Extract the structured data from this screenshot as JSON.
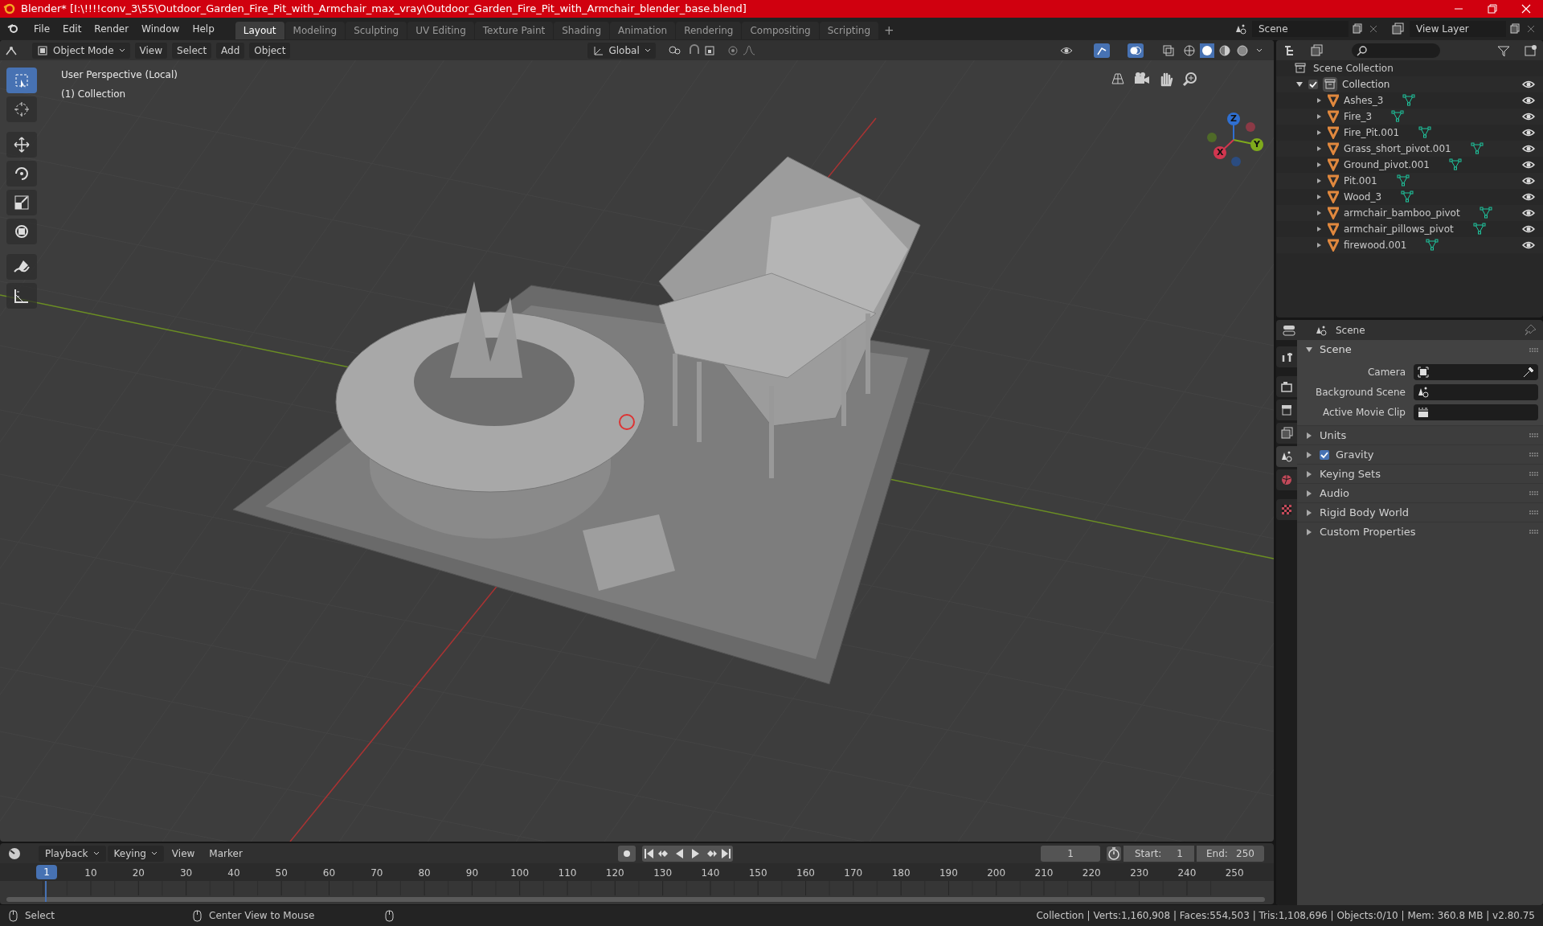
{
  "title_bar": {
    "title": "Blender* [I:\\!!!!conv_3\\55\\Outdoor_Garden_Fire_Pit_with_Armchair_max_vray\\Outdoor_Garden_Fire_Pit_with_Armchair_blender_base.blend]"
  },
  "menu": [
    "File",
    "Edit",
    "Render",
    "Window",
    "Help"
  ],
  "workspaces": [
    {
      "label": "Layout",
      "selected": true
    },
    {
      "label": "Modeling",
      "selected": false
    },
    {
      "label": "Sculpting",
      "selected": false
    },
    {
      "label": "UV Editing",
      "selected": false
    },
    {
      "label": "Texture Paint",
      "selected": false
    },
    {
      "label": "Shading",
      "selected": false
    },
    {
      "label": "Animation",
      "selected": false
    },
    {
      "label": "Rendering",
      "selected": false
    },
    {
      "label": "Compositing",
      "selected": false
    },
    {
      "label": "Scripting",
      "selected": false
    }
  ],
  "add_workspace": "+",
  "scene_field": "Scene",
  "view_layer_field": "View Layer",
  "viewport": {
    "mode": "Object Mode",
    "menus": [
      "View",
      "Select",
      "Add",
      "Object"
    ],
    "orientation": "Global",
    "overlay_text": [
      "User Perspective (Local)",
      "(1) Collection"
    ],
    "tools": [
      {
        "kind": "select",
        "selected": true
      },
      {
        "kind": "cursor",
        "selected": false
      },
      {
        "kind": "move",
        "selected": false
      },
      {
        "kind": "rotate",
        "selected": false
      },
      {
        "kind": "scale",
        "selected": false
      },
      {
        "kind": "transform",
        "selected": false
      },
      {
        "kind": "annotate",
        "selected": false
      },
      {
        "kind": "measure",
        "selected": false
      }
    ],
    "gizmo_axes": [
      "Z",
      "Y",
      "X"
    ]
  },
  "outliner": {
    "root": "Scene Collection",
    "collection": {
      "label": "Collection",
      "checked": true,
      "expanded": true,
      "children": [
        {
          "label": "Ashes_3"
        },
        {
          "label": "Fire_3"
        },
        {
          "label": "Fire_Pit.001"
        },
        {
          "label": "Grass_short_pivot.001"
        },
        {
          "label": "Ground_pivot.001"
        },
        {
          "label": "Pit.001"
        },
        {
          "label": "Wood_3"
        },
        {
          "label": "armchair_bamboo_pivot"
        },
        {
          "label": "armchair_pillows_pivot"
        },
        {
          "label": "firewood.001"
        }
      ]
    }
  },
  "properties": {
    "header": "Scene",
    "tabs": [
      {
        "kind": "tool",
        "selected": false
      },
      {
        "kind": "render",
        "selected": false
      },
      {
        "kind": "output",
        "selected": false
      },
      {
        "kind": "view_layer",
        "selected": false
      },
      {
        "kind": "scene",
        "selected": true
      },
      {
        "kind": "world",
        "selected": false
      },
      {
        "kind": "texture",
        "selected": false
      }
    ],
    "panel": {
      "title": "Scene",
      "expanded": true,
      "fields": [
        {
          "label": "Camera",
          "kind": "camera"
        },
        {
          "label": "Background Scene",
          "kind": "scene"
        },
        {
          "label": "Active Movie Clip",
          "kind": "clip"
        }
      ]
    },
    "sections": [
      {
        "label": "Units",
        "kind": "plain"
      },
      {
        "label": "Gravity",
        "kind": "checkbox",
        "checked": true
      },
      {
        "label": "Keying Sets",
        "kind": "plain"
      },
      {
        "label": "Audio",
        "kind": "plain"
      },
      {
        "label": "Rigid Body World",
        "kind": "plain"
      },
      {
        "label": "Custom Properties",
        "kind": "plain"
      }
    ]
  },
  "timeline": {
    "menus": [
      {
        "label": "Playback",
        "kind": "dropdown"
      },
      {
        "label": "Keying",
        "kind": "dropdown"
      },
      {
        "label": "View",
        "kind": "plain"
      },
      {
        "label": "Marker",
        "kind": "plain"
      }
    ],
    "current_frame": "1",
    "playhead_frame": "1",
    "start_label": "Start:",
    "start": "1",
    "end_label": "End:",
    "end": "250",
    "ruler": [
      "10",
      "20",
      "30",
      "40",
      "50",
      "60",
      "70",
      "80",
      "90",
      "100",
      "110",
      "120",
      "130",
      "140",
      "150",
      "160",
      "170",
      "180",
      "190",
      "200",
      "210",
      "220",
      "230",
      "240",
      "250"
    ]
  },
  "status_bar": {
    "hints": [
      "Select",
      "Center View to Mouse"
    ],
    "stats": "Collection | Verts:1,160,908 | Faces:554,503 | Tris:1,108,696 | Objects:0/10 | Mem: 360.8 MB | v2.80.75"
  }
}
